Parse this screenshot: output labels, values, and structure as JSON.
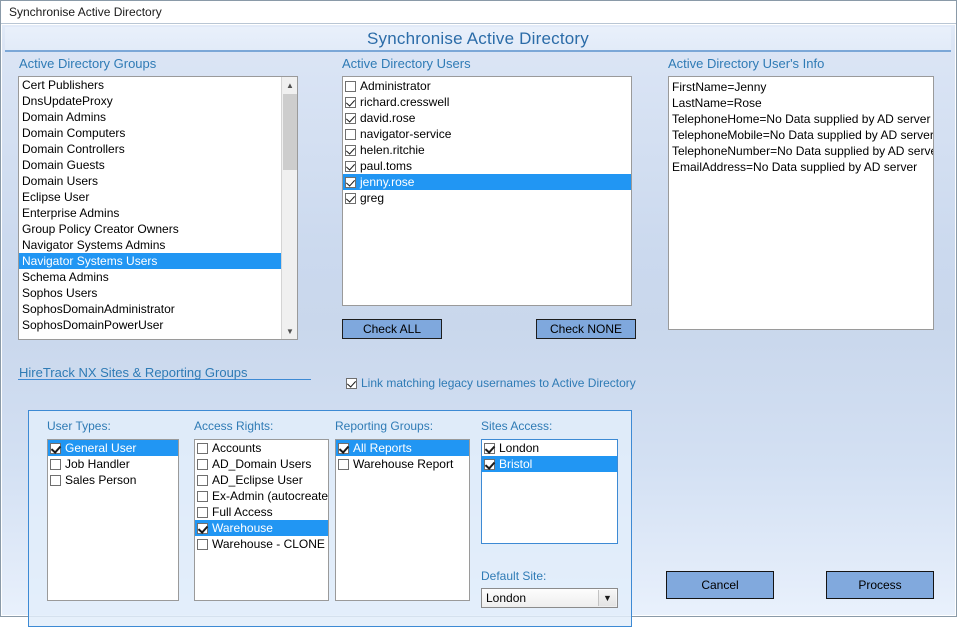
{
  "window": {
    "title": "Synchronise Active Directory"
  },
  "banner": {
    "title": "Synchronise Active Directory"
  },
  "colors": {
    "accent": "#2f7bb5",
    "selection": "#2196f3",
    "button": "#7fa8dd",
    "group_border": "#3d8ad4",
    "background": "#cbd9ee"
  },
  "groups_panel": {
    "label": "Active Directory Groups",
    "items": [
      {
        "name": "Cert Publishers",
        "selected": false
      },
      {
        "name": "DnsUpdateProxy",
        "selected": false
      },
      {
        "name": "Domain Admins",
        "selected": false
      },
      {
        "name": "Domain Computers",
        "selected": false
      },
      {
        "name": "Domain Controllers",
        "selected": false
      },
      {
        "name": "Domain Guests",
        "selected": false
      },
      {
        "name": "Domain Users",
        "selected": false
      },
      {
        "name": "Eclipse User",
        "selected": false
      },
      {
        "name": "Enterprise Admins",
        "selected": false
      },
      {
        "name": "Group Policy Creator Owners",
        "selected": false
      },
      {
        "name": "Navigator Systems Admins",
        "selected": false
      },
      {
        "name": "Navigator Systems Users",
        "selected": true
      },
      {
        "name": "Schema Admins",
        "selected": false
      },
      {
        "name": "Sophos Users",
        "selected": false
      },
      {
        "name": "SophosDomainAdministrator",
        "selected": false
      },
      {
        "name": "SophosDomainPowerUser",
        "selected": false
      }
    ],
    "scroll_up_icon": "▲",
    "scroll_down_icon": "▼"
  },
  "users_panel": {
    "label": "Active Directory Users",
    "items": [
      {
        "name": "Administrator",
        "checked": false,
        "selected": false
      },
      {
        "name": "richard.cresswell",
        "checked": true,
        "selected": false
      },
      {
        "name": "david.rose",
        "checked": true,
        "selected": false
      },
      {
        "name": "navigator-service",
        "checked": false,
        "selected": false
      },
      {
        "name": "helen.ritchie",
        "checked": true,
        "selected": false
      },
      {
        "name": "paul.toms",
        "checked": true,
        "selected": false
      },
      {
        "name": "jenny.rose",
        "checked": true,
        "selected": true
      },
      {
        "name": "greg",
        "checked": true,
        "selected": false
      }
    ],
    "check_all_label": "Check ALL",
    "check_none_label": "Check NONE",
    "link_legacy": {
      "label": "Link matching legacy usernames to Active Directory",
      "checked": true
    }
  },
  "user_info_panel": {
    "label": "Active Directory User's Info",
    "lines": [
      "FirstName=Jenny",
      "LastName=Rose",
      "TelephoneHome=No Data supplied by AD server",
      "TelephoneMobile=No Data supplied by AD server",
      "TelephoneNumber=No Data supplied by AD server",
      "EmailAddress=No Data supplied by AD server"
    ]
  },
  "hiretrack": {
    "label": "HireTrack NX Sites & Reporting Groups",
    "user_types": {
      "label": "User Types:",
      "items": [
        {
          "name": "General User",
          "checked": true,
          "selected": true
        },
        {
          "name": "Job Handler",
          "checked": false,
          "selected": false
        },
        {
          "name": "Sales Person",
          "checked": false,
          "selected": false
        }
      ]
    },
    "access_rights": {
      "label": "Access Rights:",
      "items": [
        {
          "name": "Accounts",
          "checked": false,
          "selected": false
        },
        {
          "name": "AD_Domain Users",
          "checked": false,
          "selected": false
        },
        {
          "name": "AD_Eclipse User",
          "checked": false,
          "selected": false
        },
        {
          "name": "Ex-Admin (autocreated)",
          "checked": false,
          "selected": false
        },
        {
          "name": "Full Access",
          "checked": false,
          "selected": false
        },
        {
          "name": "Warehouse",
          "checked": true,
          "selected": true
        },
        {
          "name": "Warehouse - CLONE",
          "checked": false,
          "selected": false
        }
      ]
    },
    "reporting_groups": {
      "label": "Reporting Groups:",
      "items": [
        {
          "name": "All Reports",
          "checked": true,
          "selected": true
        },
        {
          "name": "Warehouse Report",
          "checked": false,
          "selected": false
        }
      ]
    },
    "sites_access": {
      "label": "Sites Access:",
      "items": [
        {
          "name": "London",
          "checked": true,
          "selected": false
        },
        {
          "name": "Bristol",
          "checked": true,
          "selected": true
        }
      ]
    },
    "default_site": {
      "label": "Default Site:",
      "value": "London",
      "dropdown_icon": "▼"
    }
  },
  "actions": {
    "cancel_label": "Cancel",
    "process_label": "Process"
  }
}
